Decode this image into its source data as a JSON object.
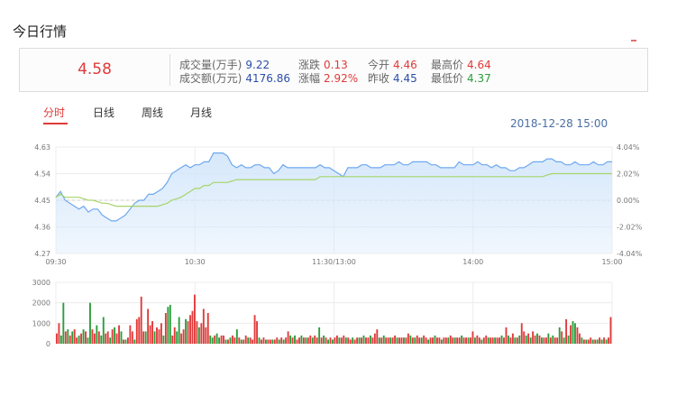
{
  "section_title": "今日行情",
  "quote": {
    "price": "4.58",
    "rows": [
      [
        {
          "label": "成交量(万手)",
          "value": "9.22",
          "color": "#2b4ea8"
        },
        {
          "label": "涨跌",
          "value": "0.13",
          "color": "#e03a3a"
        },
        {
          "label": "今开",
          "value": "4.46",
          "color": "#e03a3a"
        },
        {
          "label": "最高价",
          "value": "4.64",
          "color": "#e03a3a"
        }
      ],
      [
        {
          "label": "成交额(万元)",
          "value": "4176.86",
          "color": "#2b4ea8"
        },
        {
          "label": "涨幅",
          "value": "2.92%",
          "color": "#e03a3a"
        },
        {
          "label": "昨收",
          "value": "4.45",
          "color": "#2b4ea8"
        },
        {
          "label": "最低价",
          "value": "4.37",
          "color": "#2a9d3a"
        }
      ]
    ]
  },
  "tabs": [
    {
      "label": "分时",
      "active": true
    },
    {
      "label": "日线",
      "active": false
    },
    {
      "label": "周线",
      "active": false
    },
    {
      "label": "月线",
      "active": false
    }
  ],
  "datetime": "2018-12-28 15:00",
  "colors": {
    "up": "#e03a3a",
    "down": "#2a9d3a",
    "price_line": "#6ea8ef",
    "price_fill": "#d6e8fb",
    "avg_line": "#a6d46a"
  },
  "chart_data": [
    {
      "type": "area",
      "y_ticks": [
        "4.63",
        "4.54",
        "4.45",
        "4.36",
        "4.27"
      ],
      "y_tick_values": [
        4.63,
        4.54,
        4.45,
        4.36,
        4.27
      ],
      "y2_ticks": [
        "4.04%",
        "2.02%",
        "0.00%",
        "-2.02%",
        "-4.04%"
      ],
      "x_ticks": [
        "09:30",
        "10:30",
        "11:30/13:00",
        "14:00",
        "15:00"
      ],
      "x_tick_values": [
        0,
        60,
        120,
        180,
        240
      ],
      "ylim": [
        4.27,
        4.63
      ],
      "xlim": [
        0,
        240
      ],
      "baseline": 4.45,
      "series": [
        {
          "x": [
            0,
            2,
            4,
            6,
            8,
            10,
            12,
            14,
            16,
            18,
            20,
            22,
            24,
            26,
            28,
            30,
            32,
            34,
            36,
            38,
            40,
            42,
            44,
            46,
            48,
            50,
            52,
            54,
            56,
            58,
            60,
            62,
            64,
            66,
            68,
            70,
            72,
            74,
            76,
            78,
            80,
            82,
            84,
            86,
            88,
            90,
            92,
            94,
            96,
            98,
            100,
            102,
            104,
            106,
            108,
            110,
            112,
            114,
            116,
            118,
            120,
            122,
            124,
            126,
            128,
            130,
            132,
            134,
            136,
            138,
            140,
            142,
            144,
            146,
            148,
            150,
            152,
            154,
            156,
            158,
            160,
            162,
            164,
            166,
            168,
            170,
            172,
            174,
            176,
            178,
            180,
            182,
            184,
            186,
            188,
            190,
            192,
            194,
            196,
            198,
            200,
            202,
            204,
            206,
            208,
            210,
            212,
            214,
            216,
            218,
            220,
            222,
            224,
            226,
            228,
            230,
            232,
            234,
            236,
            238,
            240
          ],
          "values": [
            4.46,
            4.48,
            4.45,
            4.44,
            4.43,
            4.42,
            4.43,
            4.41,
            4.42,
            4.42,
            4.4,
            4.39,
            4.38,
            4.38,
            4.39,
            4.4,
            4.42,
            4.44,
            4.45,
            4.45,
            4.47,
            4.47,
            4.48,
            4.49,
            4.51,
            4.54,
            4.55,
            4.56,
            4.57,
            4.56,
            4.57,
            4.57,
            4.58,
            4.58,
            4.61,
            4.61,
            4.61,
            4.6,
            4.57,
            4.56,
            4.57,
            4.56,
            4.56,
            4.57,
            4.57,
            4.56,
            4.56,
            4.54,
            4.55,
            4.57,
            4.56,
            4.56,
            4.56,
            4.56,
            4.56,
            4.56,
            4.56,
            4.57,
            4.56,
            4.56,
            4.55,
            4.54,
            4.53,
            4.56,
            4.56,
            4.56,
            4.57,
            4.57,
            4.56,
            4.56,
            4.56,
            4.57,
            4.57,
            4.57,
            4.58,
            4.57,
            4.57,
            4.58,
            4.58,
            4.58,
            4.58,
            4.57,
            4.57,
            4.56,
            4.56,
            4.56,
            4.56,
            4.58,
            4.57,
            4.57,
            4.57,
            4.58,
            4.57,
            4.57,
            4.56,
            4.57,
            4.56,
            4.56,
            4.55,
            4.55,
            4.56,
            4.56,
            4.57,
            4.58,
            4.58,
            4.58,
            4.59,
            4.59,
            4.58,
            4.58,
            4.57,
            4.57,
            4.58,
            4.57,
            4.57,
            4.57,
            4.58,
            4.57,
            4.57,
            4.58,
            4.58
          ]
        },
        {
          "x": [
            0,
            2,
            4,
            6,
            8,
            10,
            12,
            14,
            16,
            18,
            20,
            22,
            24,
            26,
            28,
            30,
            32,
            34,
            36,
            38,
            40,
            42,
            44,
            46,
            48,
            50,
            52,
            54,
            56,
            58,
            60,
            62,
            64,
            66,
            68,
            70,
            72,
            74,
            76,
            78,
            80,
            82,
            84,
            86,
            88,
            90,
            92,
            94,
            96,
            98,
            100,
            102,
            104,
            106,
            108,
            110,
            112,
            114,
            116,
            118,
            120,
            122,
            124,
            126,
            128,
            130,
            132,
            134,
            136,
            138,
            140,
            142,
            144,
            146,
            148,
            150,
            152,
            154,
            156,
            158,
            160,
            162,
            164,
            166,
            168,
            170,
            172,
            174,
            176,
            178,
            180,
            182,
            184,
            186,
            188,
            190,
            192,
            194,
            196,
            198,
            200,
            202,
            204,
            206,
            208,
            210,
            212,
            214,
            216,
            218,
            220,
            222,
            224,
            226,
            228,
            230,
            232,
            234,
            236,
            238,
            240
          ],
          "values": [
            4.46,
            4.47,
            4.46,
            4.46,
            4.46,
            4.46,
            4.455,
            4.45,
            4.45,
            4.445,
            4.44,
            4.44,
            4.435,
            4.43,
            4.43,
            4.43,
            4.43,
            4.43,
            4.43,
            4.43,
            4.43,
            4.43,
            4.43,
            4.435,
            4.44,
            4.45,
            4.455,
            4.46,
            4.47,
            4.48,
            4.49,
            4.49,
            4.5,
            4.5,
            4.51,
            4.51,
            4.51,
            4.51,
            4.515,
            4.52,
            4.52,
            4.52,
            4.52,
            4.52,
            4.52,
            4.52,
            4.52,
            4.52,
            4.52,
            4.52,
            4.52,
            4.52,
            4.52,
            4.52,
            4.52,
            4.52,
            4.52,
            4.53,
            4.53,
            4.53,
            4.53,
            4.53,
            4.53,
            4.53,
            4.53,
            4.53,
            4.53,
            4.53,
            4.53,
            4.53,
            4.53,
            4.53,
            4.53,
            4.53,
            4.53,
            4.53,
            4.53,
            4.53,
            4.53,
            4.53,
            4.53,
            4.53,
            4.53,
            4.53,
            4.53,
            4.53,
            4.53,
            4.53,
            4.53,
            4.53,
            4.53,
            4.53,
            4.53,
            4.53,
            4.53,
            4.53,
            4.53,
            4.53,
            4.53,
            4.53,
            4.53,
            4.53,
            4.53,
            4.53,
            4.53,
            4.53,
            4.535,
            4.54,
            4.54,
            4.54,
            4.54,
            4.54,
            4.54,
            4.54,
            4.54,
            4.54,
            4.54,
            4.54,
            4.54,
            4.54,
            4.54
          ]
        }
      ]
    },
    {
      "type": "bar",
      "y_ticks": [
        "3000",
        "2000",
        "1000",
        "0"
      ],
      "y_tick_values": [
        3000,
        2000,
        1000,
        0
      ],
      "ylim": [
        0,
        3000
      ],
      "xlim": [
        0,
        240
      ],
      "values": [
        500,
        1000,
        400,
        2000,
        600,
        700,
        400,
        600,
        700,
        300,
        400,
        500,
        700,
        600,
        300,
        2000,
        700,
        500,
        900,
        600,
        400,
        1300,
        500,
        600,
        300,
        700,
        800,
        500,
        900,
        600,
        200,
        200,
        300,
        900,
        600,
        200,
        1200,
        1300,
        2300,
        600,
        600,
        1700,
        900,
        1100,
        600,
        800,
        700,
        1000,
        400,
        1500,
        1800,
        1900,
        400,
        800,
        600,
        1300,
        500,
        700,
        1200,
        1100,
        1400,
        1600,
        2400,
        1100,
        800,
        1000,
        1700,
        800,
        1500,
        400,
        300,
        400,
        500,
        300,
        400,
        400,
        200,
        200,
        300,
        400,
        300,
        700,
        300,
        200,
        200,
        400,
        300,
        300,
        200,
        1400,
        1100,
        300,
        200,
        300,
        200,
        200,
        200,
        200,
        200,
        300,
        200,
        300,
        200,
        300,
        600,
        400,
        300,
        400,
        200,
        300,
        400,
        300,
        300,
        300,
        400,
        300,
        400,
        300,
        800,
        300,
        400,
        300,
        200,
        300,
        200,
        300,
        400,
        300,
        300,
        400,
        300,
        300,
        200,
        300,
        200,
        300,
        300,
        300,
        400,
        300,
        300,
        400,
        300,
        500,
        700,
        300,
        300,
        400,
        300,
        300,
        300,
        300,
        400,
        300,
        300,
        300,
        300,
        300,
        500,
        400,
        300,
        300,
        400,
        300,
        300,
        400,
        300,
        200,
        300,
        300,
        400,
        300,
        300,
        200,
        300,
        300,
        300,
        400,
        300,
        300,
        300,
        300,
        400,
        300,
        300,
        300,
        300,
        600,
        300,
        400,
        300,
        200,
        300,
        400,
        300,
        300,
        300,
        300,
        300,
        300,
        400,
        300,
        800,
        400,
        300,
        500,
        300,
        300,
        400,
        1000,
        600,
        400,
        500,
        300,
        600,
        400,
        500,
        400,
        300,
        300,
        300,
        500,
        300,
        400,
        300,
        300,
        800,
        600,
        300,
        1200,
        400,
        900,
        1100,
        1000,
        800,
        500,
        300,
        200,
        200,
        200,
        300,
        200,
        200,
        200,
        300,
        200,
        300,
        200,
        300,
        1300
      ],
      "directions": [
        "u",
        "u",
        "d",
        "d",
        "u",
        "d",
        "u",
        "d",
        "u",
        "u",
        "d",
        "u",
        "d",
        "u",
        "d",
        "d",
        "u",
        "u",
        "d",
        "u",
        "d",
        "d",
        "u",
        "u",
        "d",
        "u",
        "d",
        "u",
        "u",
        "d",
        "u",
        "d",
        "u",
        "u",
        "u",
        "d",
        "u",
        "u",
        "u",
        "u",
        "d",
        "u",
        "u",
        "u",
        "d",
        "u",
        "u",
        "u",
        "d",
        "u",
        "d",
        "d",
        "u",
        "u",
        "d",
        "d",
        "u",
        "u",
        "d",
        "u",
        "u",
        "u",
        "u",
        "u",
        "d",
        "u",
        "u",
        "u",
        "u",
        "d",
        "d",
        "u",
        "d",
        "d",
        "u",
        "u",
        "d",
        "u",
        "d",
        "u",
        "u",
        "d",
        "u",
        "d",
        "u",
        "u",
        "d",
        "u",
        "u",
        "u",
        "u",
        "d",
        "u",
        "u",
        "d",
        "u",
        "u",
        "d",
        "u",
        "u",
        "d",
        "u",
        "d",
        "u",
        "u",
        "d",
        "u",
        "d",
        "u",
        "u",
        "d",
        "u",
        "d",
        "u",
        "u",
        "d",
        "u",
        "u",
        "d",
        "u",
        "d",
        "u",
        "d",
        "u",
        "d",
        "u",
        "u",
        "d",
        "u",
        "u",
        "d",
        "u",
        "u",
        "d",
        "u",
        "u",
        "d",
        "u",
        "d",
        "u",
        "u",
        "d",
        "u",
        "u",
        "u",
        "d",
        "u",
        "d",
        "u",
        "u",
        "d",
        "u",
        "u",
        "d",
        "u",
        "u",
        "d",
        "u",
        "u",
        "d",
        "u",
        "d",
        "u",
        "u",
        "d",
        "u",
        "u",
        "d",
        "u",
        "u",
        "d",
        "u",
        "u",
        "d",
        "u",
        "u",
        "d",
        "u",
        "u",
        "d",
        "u",
        "u",
        "d",
        "u",
        "u",
        "d",
        "u",
        "u",
        "d",
        "u",
        "u",
        "d",
        "u",
        "u",
        "d",
        "u",
        "u",
        "d",
        "u",
        "u",
        "d",
        "u",
        "u",
        "d",
        "u",
        "u",
        "d",
        "u",
        "d",
        "u",
        "u",
        "d",
        "u",
        "d",
        "u",
        "u",
        "d",
        "u",
        "d",
        "u",
        "u",
        "d",
        "u",
        "d",
        "u",
        "u",
        "d",
        "u",
        "d",
        "u",
        "d",
        "u",
        "d",
        "d",
        "u",
        "u",
        "d",
        "u",
        "d",
        "u",
        "u",
        "d",
        "u",
        "d",
        "u",
        "d",
        "u",
        "d",
        "u",
        "u"
      ]
    }
  ]
}
